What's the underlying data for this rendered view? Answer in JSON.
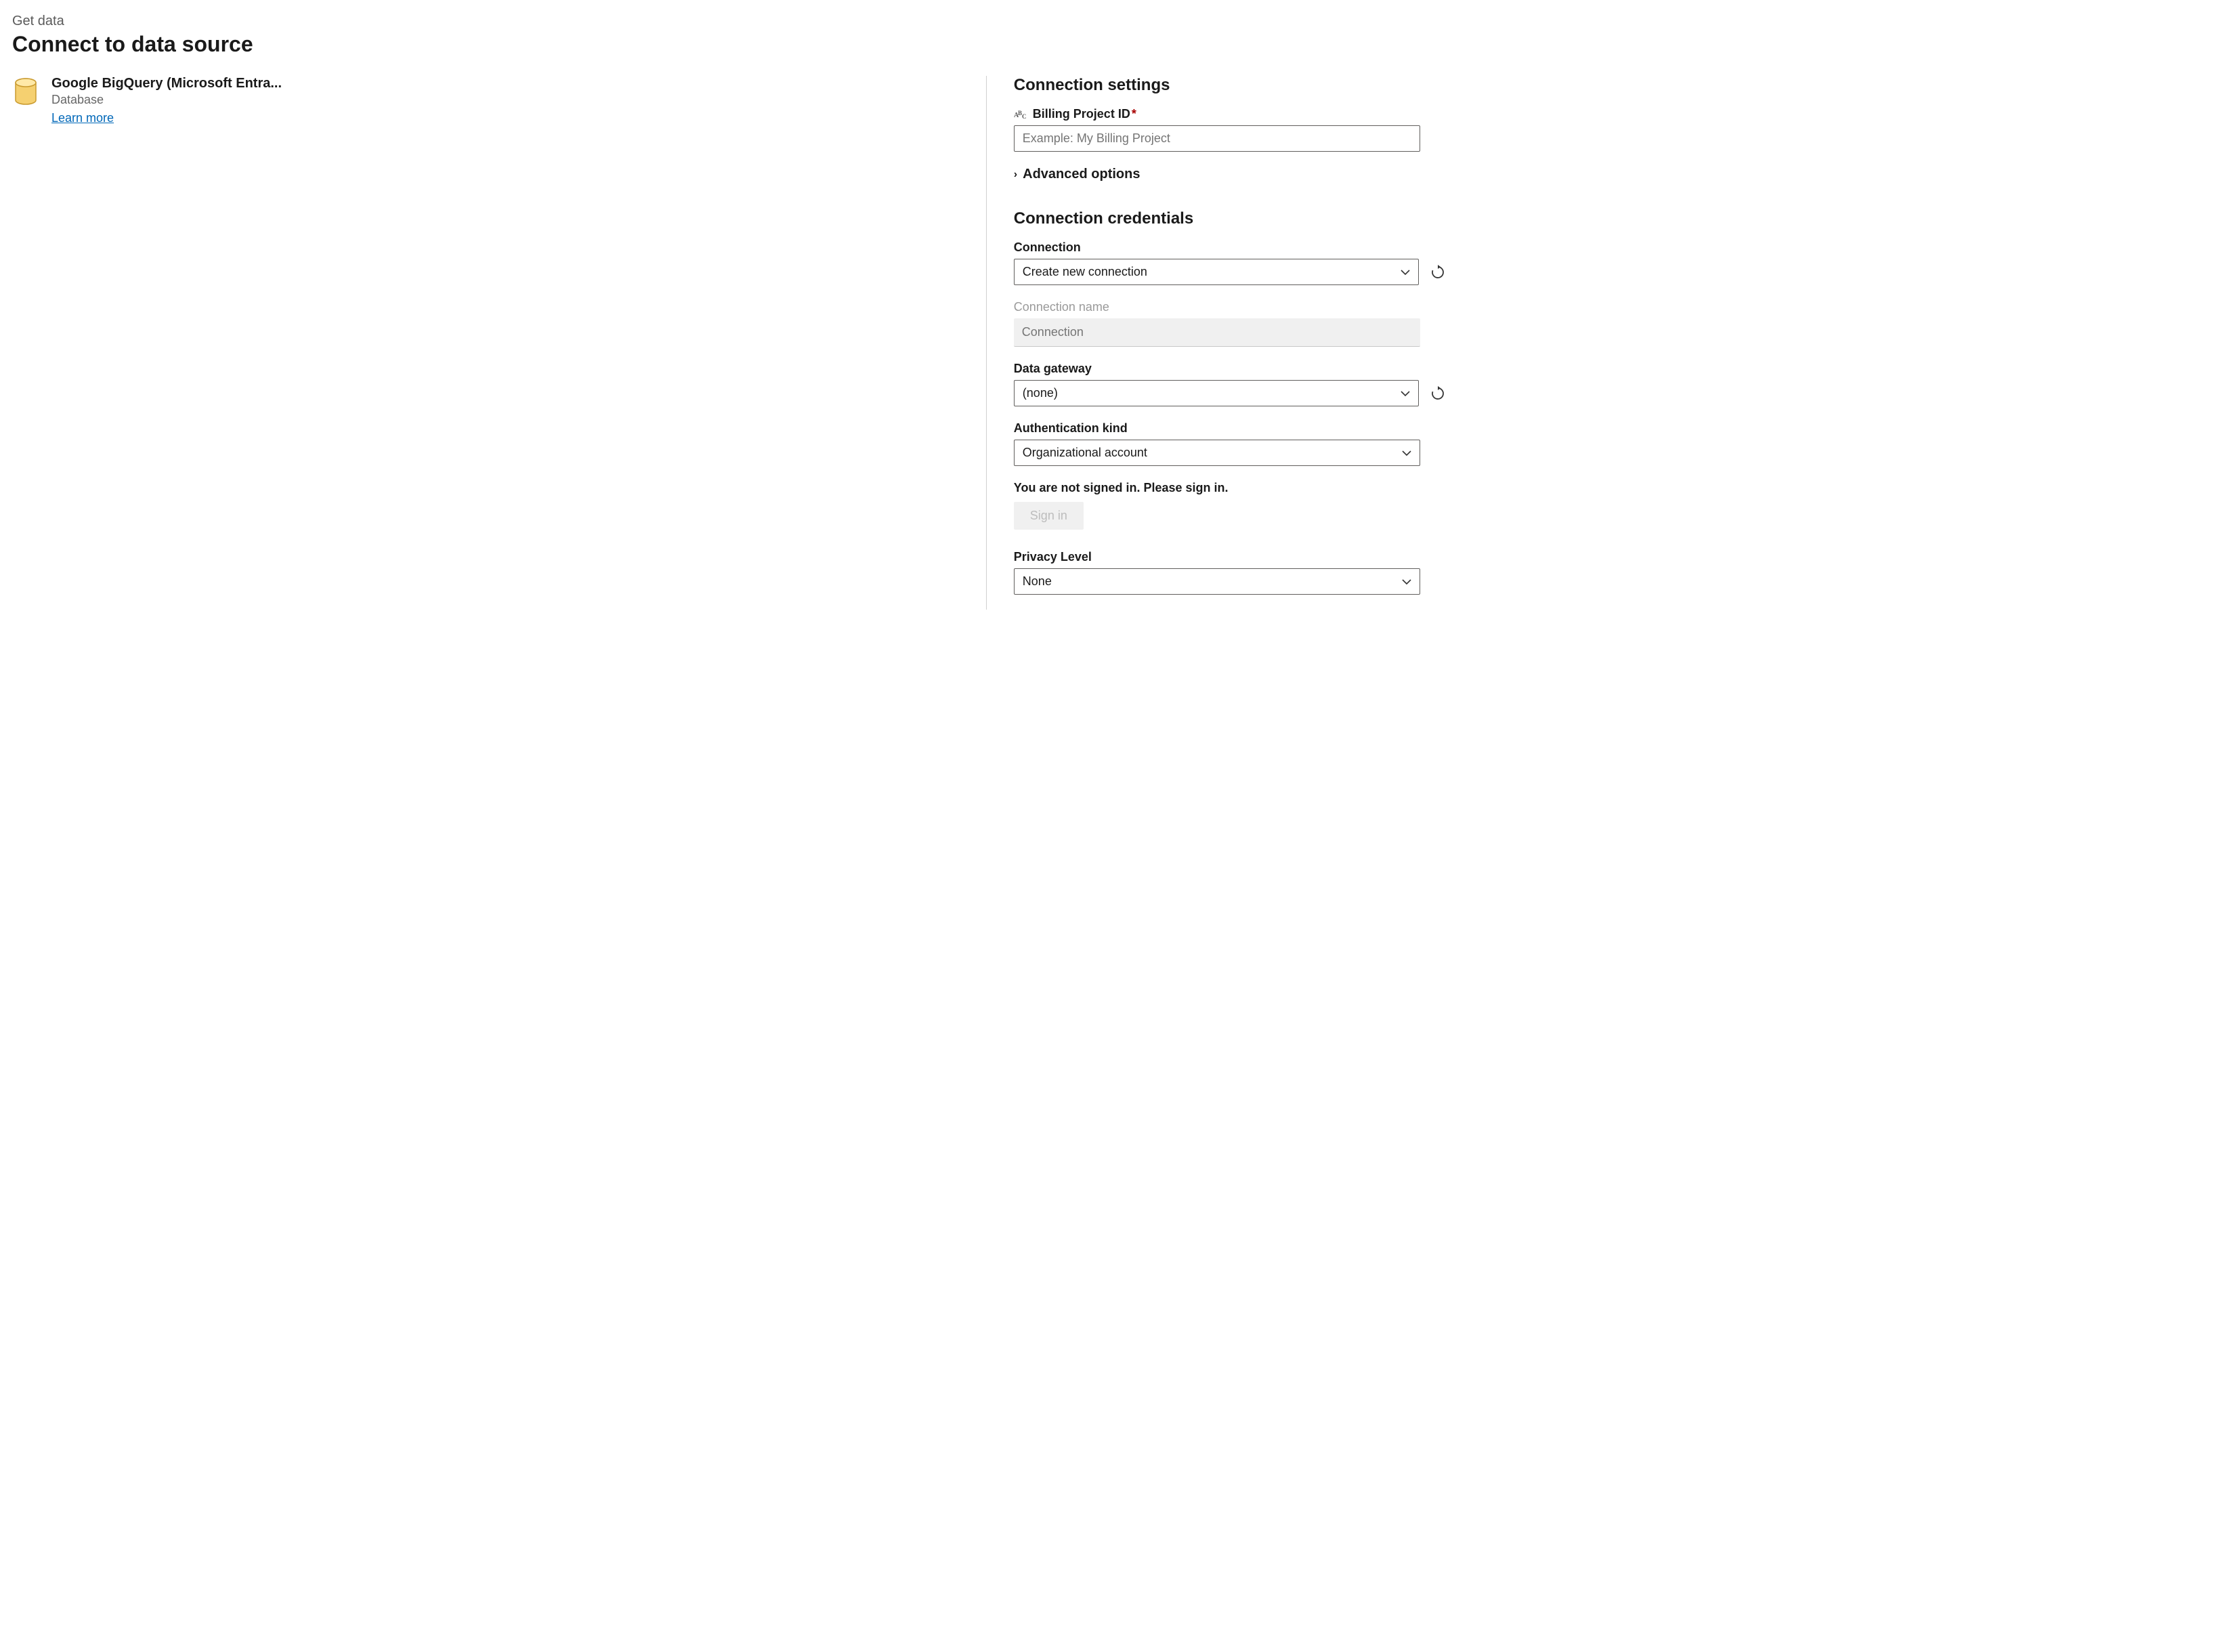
{
  "header": {
    "breadcrumb": "Get data",
    "title": "Connect to data source"
  },
  "source": {
    "name": "Google BigQuery (Microsoft Entra...",
    "category": "Database",
    "learn_more": "Learn more"
  },
  "settings": {
    "section_title": "Connection settings",
    "billing_project": {
      "label": "Billing Project ID",
      "placeholder": "Example: My Billing Project",
      "required_marker": "*"
    },
    "advanced_label": "Advanced options"
  },
  "credentials": {
    "section_title": "Connection credentials",
    "connection": {
      "label": "Connection",
      "value": "Create new connection"
    },
    "connection_name": {
      "label": "Connection name",
      "placeholder": "Connection"
    },
    "data_gateway": {
      "label": "Data gateway",
      "value": "(none)"
    },
    "auth_kind": {
      "label": "Authentication kind",
      "value": "Organizational account"
    },
    "signin_message": "You are not signed in. Please sign in.",
    "signin_button": "Sign in",
    "privacy_level": {
      "label": "Privacy Level",
      "value": "None"
    }
  }
}
